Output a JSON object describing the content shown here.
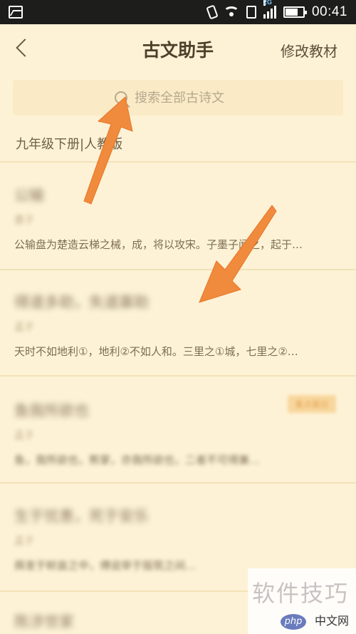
{
  "status_bar": {
    "time": "00:41",
    "network": "2G",
    "battery_level": 0.7
  },
  "header": {
    "title": "古文助手",
    "edit_label": "修改教材"
  },
  "search": {
    "placeholder": "搜索全部古诗文"
  },
  "grade": {
    "label": "九年级下册|人教版"
  },
  "items": [
    {
      "title": "公输",
      "author": "墨子",
      "text": "公输盘为楚造云梯之械，成，将以攻宋。子墨子闻之，起于…"
    },
    {
      "title": "得道多助，失道寡助",
      "author": "孟子",
      "text": "天时不如地利①，地利②不如人和。三里之①城，七里之②…"
    },
    {
      "title": "鱼我所欲也",
      "author": "孟子",
      "text": "鱼，我所欲也，熊掌，亦我所欲也，二者不可得兼…",
      "badge": "重点篇目"
    },
    {
      "title": "生于忧患，死于安乐",
      "author": "孟子",
      "text": "舜发于畎亩之中，傅说举于版筑之间…"
    },
    {
      "title": "陈涉世家"
    }
  ],
  "watermark": {
    "text": "软件技巧",
    "logo": "php",
    "site": "中文网"
  },
  "colors": {
    "background": "#fdf2d6",
    "arrow": "#f08a3c"
  }
}
